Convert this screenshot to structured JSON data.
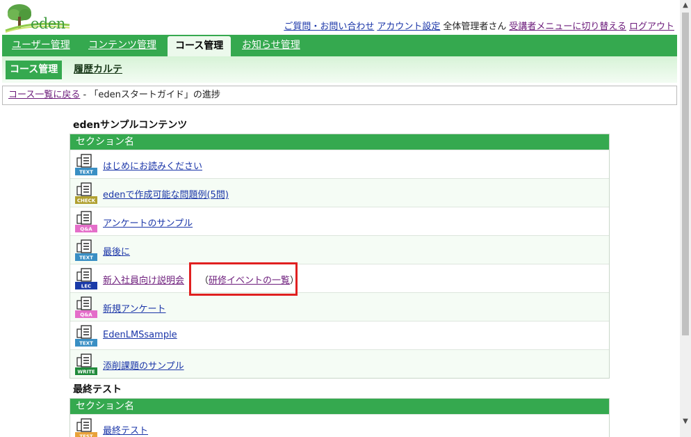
{
  "header": {
    "logo_text": "eden",
    "links": [
      {
        "label": "ご質問・お問い合わせ",
        "kind": "link"
      },
      {
        "label": "アカウント設定",
        "kind": "link"
      },
      {
        "label": "全体管理者さん",
        "kind": "text"
      },
      {
        "label": "受講者メニューに切り替える",
        "kind": "visited"
      },
      {
        "label": "ログアウト",
        "kind": "visited"
      }
    ]
  },
  "main_nav": {
    "tabs": [
      "ユーザー管理",
      "コンテンツ管理",
      "コース管理",
      "お知らせ管理"
    ],
    "active": "コース管理"
  },
  "sub_nav": {
    "tabs": [
      "コース管理",
      "履歴カルテ"
    ],
    "active": "コース管理"
  },
  "breadcrumb": {
    "back_link": "コース一覧に戻る",
    "separator": "-",
    "current": "「edenスタートガイド」の進捗"
  },
  "sections": [
    {
      "title": "edenサンプルコンテンツ",
      "header": "セクション名",
      "rows": [
        {
          "label": "はじめにお読みください",
          "icon": "text-icon",
          "badge": "TEXT",
          "badge_color": "#3a8fc4"
        },
        {
          "label": "edenで作成可能な問題例(5問)",
          "icon": "check-icon",
          "badge": "CHECK",
          "badge_color": "#b0a030"
        },
        {
          "label": "アンケートのサンプル",
          "icon": "qa-icon",
          "badge": "Q&A",
          "badge_color": "#e46ec9"
        },
        {
          "label": "最後に",
          "icon": "text-icon",
          "badge": "TEXT",
          "badge_color": "#3a8fc4"
        },
        {
          "label": "新入社員向け説明会",
          "icon": "lec-icon",
          "badge": "LEC",
          "badge_color": "#1a3aa8",
          "extra_open": "（",
          "extra_link": "研修イベントの一覧",
          "extra_close": "）"
        },
        {
          "label": "新規アンケート",
          "icon": "qa-icon",
          "badge": "Q&A",
          "badge_color": "#e46ec9"
        },
        {
          "label": "EdenLMSsample",
          "icon": "text-icon",
          "badge": "TEXT",
          "badge_color": "#3a8fc4"
        },
        {
          "label": "添削課題のサンプル",
          "icon": "write-icon",
          "badge": "WRITE",
          "badge_color": "#1f8a3a"
        }
      ]
    },
    {
      "title": "最終テスト",
      "header": "セクション名",
      "rows": [
        {
          "label": "最終テスト",
          "icon": "test-icon",
          "badge": "TEST",
          "badge_color": "#e8a23a"
        }
      ]
    }
  ]
}
